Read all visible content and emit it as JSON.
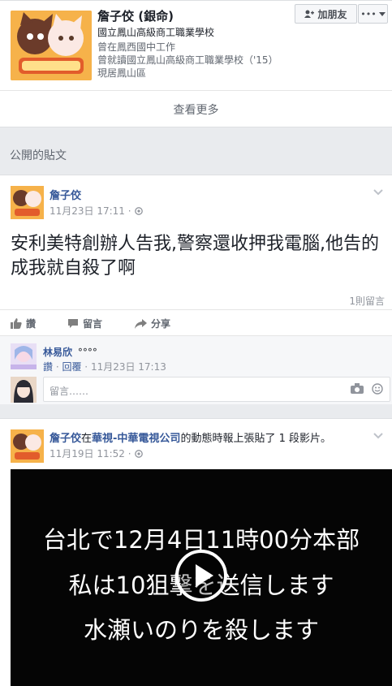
{
  "profile": {
    "name": "詹子佼 (銀命)",
    "school_current": "國立鳳山高級商工職業學校",
    "work": "曾在鳳西國中工作",
    "school_past": "曾就讀國立鳳山高級商工職業學校（'15）",
    "lives": "現居鳳山區",
    "add_friend_label": "加朋友",
    "see_more_label": "查看更多"
  },
  "section_title": "公開的貼文",
  "post1": {
    "author": "詹子佼",
    "date": "11月23日 17:11 ·",
    "text": "安利美特創辦人告我,警察還收押我電腦,他告的成我就自殺了啊",
    "comment_count": "1則留言",
    "actions": {
      "like": "讚",
      "comment": "留言",
      "share": "分享"
    },
    "comment": {
      "author": "林易欣",
      "text": "°°°°",
      "like": "讚",
      "reply": "回覆",
      "time": "11月23日 17:13"
    },
    "comment_placeholder": "留言……"
  },
  "post2": {
    "author": "詹子佼",
    "mid1": "在",
    "page": "華視-中華電視公司",
    "mid2": "的動態時報上張貼了 1 段影片。",
    "date": "11月19日 11:52 ·",
    "video_lines": [
      "台北で12月4日11時00分本部",
      "私は10狙撃を送信します",
      "水瀬いのりを殺します"
    ]
  },
  "colors": {
    "link": "#365899",
    "muted": "#90949c",
    "bg": "#e9ebee"
  }
}
